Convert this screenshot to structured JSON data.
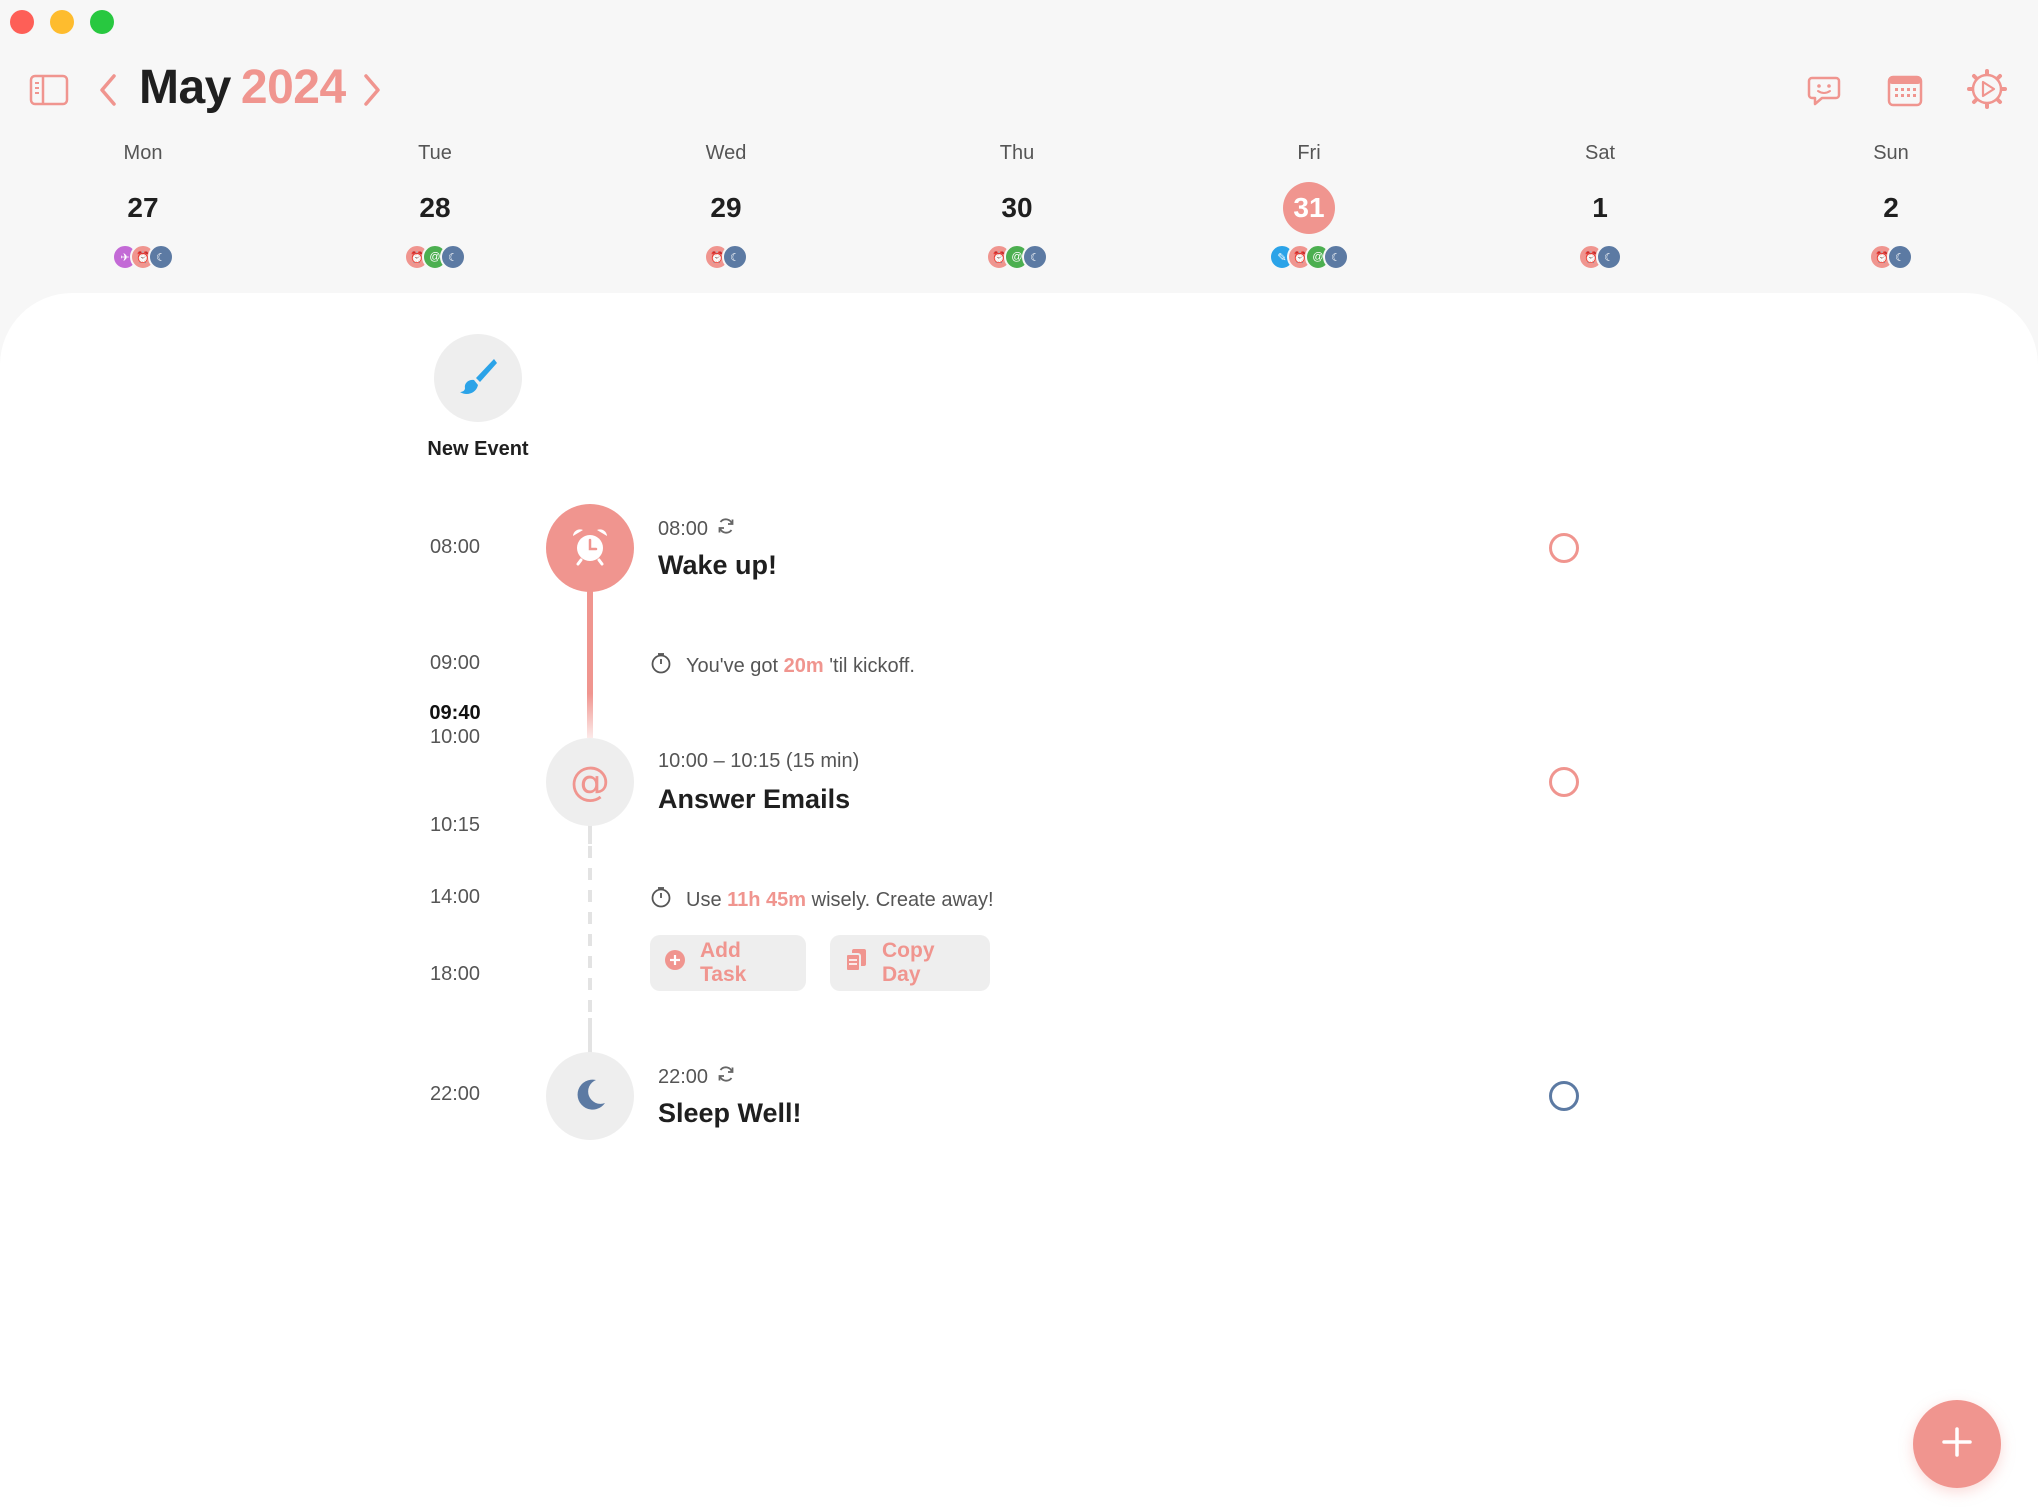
{
  "header": {
    "month": "May",
    "year": "2024"
  },
  "week": [
    {
      "name": "Mon",
      "num": "27",
      "selected": false,
      "dots": [
        "plane-icon",
        "alarm-icon",
        "moon-icon"
      ]
    },
    {
      "name": "Tue",
      "num": "28",
      "selected": false,
      "dots": [
        "alarm-icon",
        "at-icon",
        "moon-icon"
      ]
    },
    {
      "name": "Wed",
      "num": "29",
      "selected": false,
      "dots": [
        "alarm-icon",
        "moon-icon"
      ]
    },
    {
      "name": "Thu",
      "num": "30",
      "selected": false,
      "dots": [
        "alarm-icon",
        "at-icon",
        "moon-icon"
      ]
    },
    {
      "name": "Fri",
      "num": "31",
      "selected": true,
      "dots": [
        "brush-icon",
        "alarm-icon",
        "at-icon",
        "moon-icon"
      ]
    },
    {
      "name": "Sat",
      "num": "1",
      "selected": false,
      "dots": [
        "alarm-icon",
        "moon-icon"
      ]
    },
    {
      "name": "Sun",
      "num": "2",
      "selected": false,
      "dots": [
        "alarm-icon",
        "moon-icon"
      ]
    }
  ],
  "new_event": {
    "label": "New Event"
  },
  "times": {
    "t0800": "08:00",
    "t0900": "09:00",
    "now": "09:40",
    "t1000": "10:00",
    "t1015": "10:15",
    "t1400": "14:00",
    "t1800": "18:00",
    "t2200": "22:00"
  },
  "events": {
    "wake": {
      "time": "08:00",
      "title": "Wake up!"
    },
    "emails": {
      "time": "10:00 – 10:15 (15 min)",
      "title": "Answer Emails"
    },
    "sleep": {
      "time": "22:00",
      "title": "Sleep Well!"
    }
  },
  "gap1": {
    "prefix": "You've got",
    "highlight": "20m",
    "suffix": "'til kickoff."
  },
  "gap2": {
    "prefix": "Use",
    "highlight": "11h 45m",
    "suffix": "wisely. Create away!"
  },
  "actions": {
    "add_task": "Add Task",
    "copy_day": "Copy Day"
  },
  "colors": {
    "accent": "#f0958f",
    "night": "#5c7aa3",
    "brush": "#2ba3e8",
    "email_green": "#4caf50",
    "travel_purple": "#c36ad6"
  }
}
